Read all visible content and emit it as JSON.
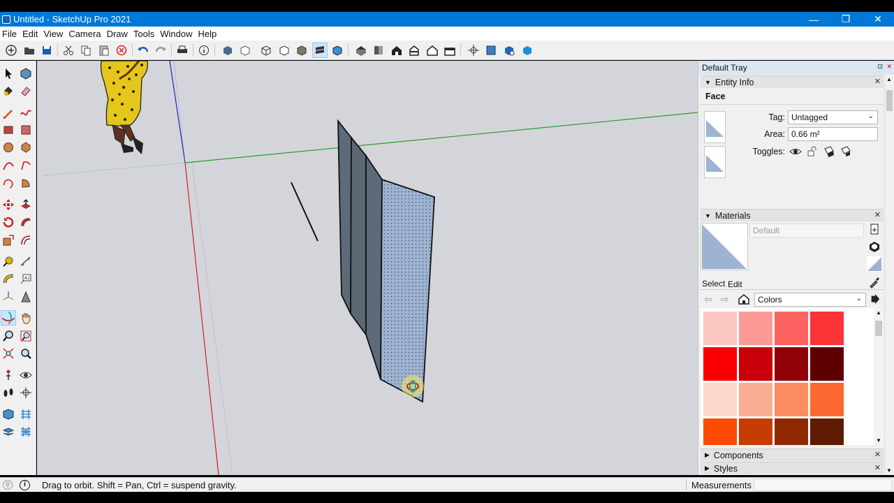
{
  "window": {
    "title": "Untitled - SketchUp Pro 2021"
  },
  "menu": [
    "File",
    "Edit",
    "View",
    "Camera",
    "Draw",
    "Tools",
    "Window",
    "Help"
  ],
  "tray": {
    "title": "Default Tray",
    "entity_info": {
      "heading": "Entity Info",
      "entity_type": "Face",
      "tag_label": "Tag:",
      "tag_value": "Untagged",
      "area_label": "Area:",
      "area_value": "0.66 m²",
      "toggles_label": "Toggles:"
    },
    "materials": {
      "heading": "Materials",
      "material_name": "Default",
      "select_tab": "Select",
      "edit_tab": "Edit",
      "library": "Colors",
      "swatches": [
        "#fcc6c3",
        "#fc9a98",
        "#fc6360",
        "#fa3437",
        "#fb0002",
        "#c9000a",
        "#8f0007",
        "#5e0002",
        "#fcd8cb",
        "#fcae95",
        "#fc8b60",
        "#fc6830",
        "#fc4a01",
        "#c73c03",
        "#8f2902",
        "#5e1a02"
      ]
    },
    "components": {
      "heading": "Components"
    },
    "styles": {
      "heading": "Styles"
    }
  },
  "status": {
    "message": "Drag to orbit. Shift = Pan, Ctrl = suspend gravity.",
    "measurements_label": "Measurements"
  },
  "colors": {
    "titlebar": "#0078d7",
    "x_axis": "#cc2222",
    "y_axis": "#2d9a2d",
    "z_axis": "#2222bb",
    "face_front": "#9eb3cf",
    "face_back": "#5d6a77"
  }
}
